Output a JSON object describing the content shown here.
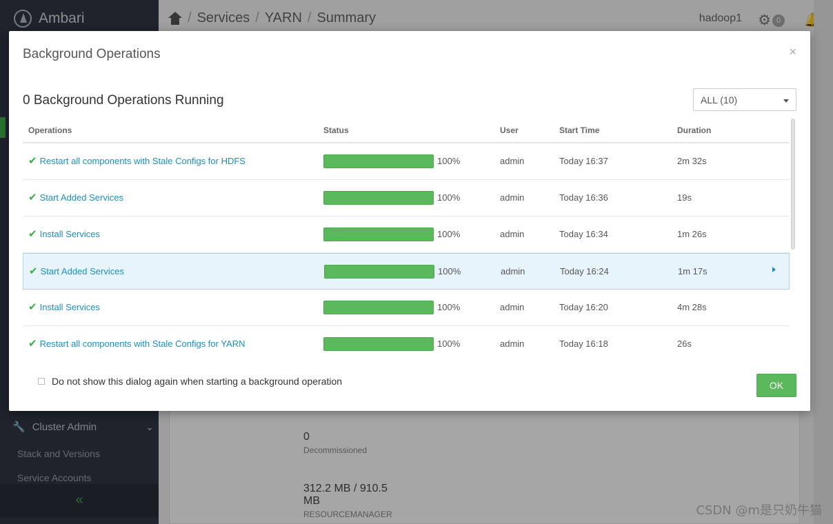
{
  "app": {
    "brand": "Ambari"
  },
  "breadcrumb": {
    "items": [
      "Services",
      "YARN",
      "Summary"
    ],
    "separator": "/"
  },
  "topbar": {
    "user": "hadoop1",
    "ops_count": "0"
  },
  "sidebar": {
    "cluster_admin_label": "Cluster Admin",
    "links": [
      "Stack and Versions",
      "Service Accounts"
    ],
    "collapse_icon": "«"
  },
  "content": {
    "decommissioned_value": "0",
    "decommissioned_label": "Decommissioned",
    "memory_value": "312.2 MB / 910.5 MB",
    "memory_label": "RESOURCEMANAGER"
  },
  "modal": {
    "title": "Background Operations",
    "close": "×",
    "running_title": "0 Background Operations Running",
    "filter_value": "ALL (10)",
    "columns": {
      "operations": "Operations",
      "status": "Status",
      "user": "User",
      "start_time": "Start Time",
      "duration": "Duration"
    },
    "rows": [
      {
        "name": "Restart all components with Stale Configs for HDFS",
        "progress": 100,
        "pct": "100%",
        "user": "admin",
        "start": "Today 16:37",
        "duration": "2m 32s"
      },
      {
        "name": "Start Added Services",
        "progress": 100,
        "pct": "100%",
        "user": "admin",
        "start": "Today 16:36",
        "duration": "19s"
      },
      {
        "name": "Install Services",
        "progress": 100,
        "pct": "100%",
        "user": "admin",
        "start": "Today 16:34",
        "duration": "1m 26s"
      },
      {
        "name": "Start Added Services",
        "progress": 100,
        "pct": "100%",
        "user": "admin",
        "start": "Today 16:24",
        "duration": "1m 17s"
      },
      {
        "name": "Install Services",
        "progress": 100,
        "pct": "100%",
        "user": "admin",
        "start": "Today 16:20",
        "duration": "4m 28s"
      },
      {
        "name": "Restart all components with Stale Configs for YARN",
        "progress": 100,
        "pct": "100%",
        "user": "admin",
        "start": "Today 16:18",
        "duration": "26s"
      }
    ],
    "check_icon": "✔",
    "dont_show_label": "Do not show this dialog again when starting a background operation",
    "ok_label": "OK"
  },
  "colors": {
    "accent_link": "#1a8fc3",
    "success": "#5cb85c",
    "sidebar_bg": "#323544"
  },
  "watermark": "CSDN @m是只奶牛猫"
}
